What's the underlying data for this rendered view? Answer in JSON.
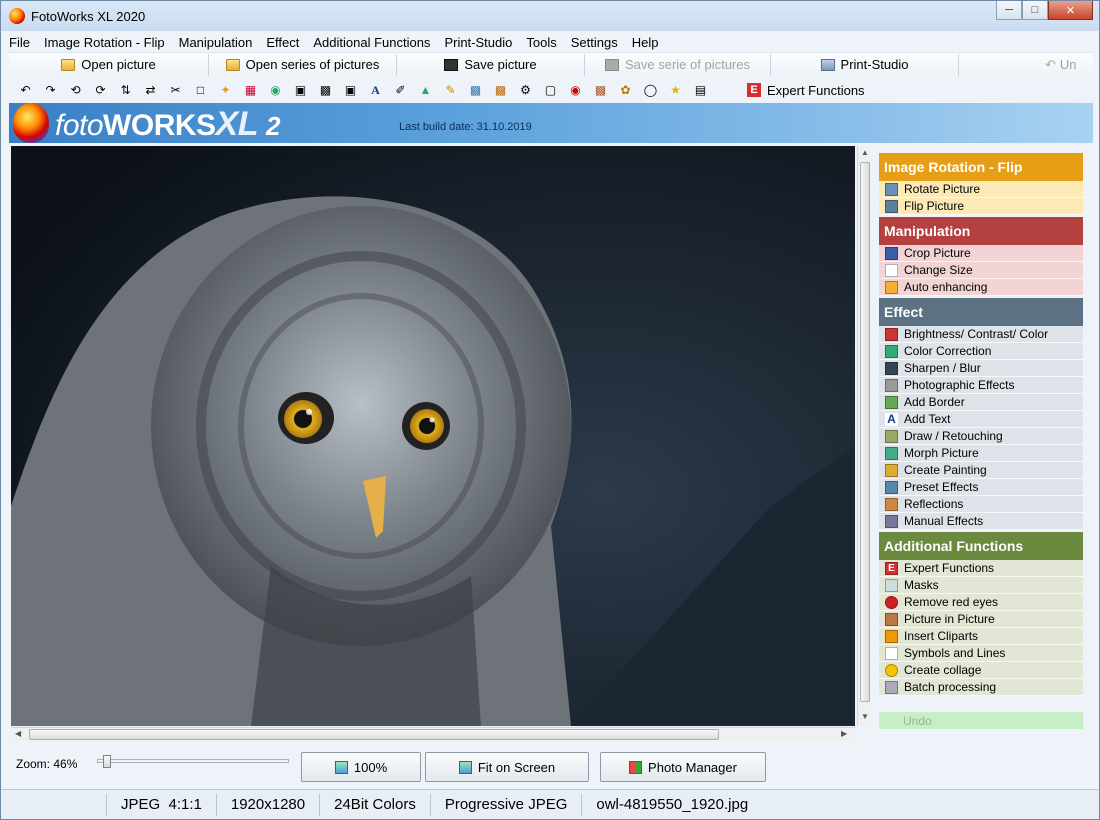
{
  "window": {
    "title": "FotoWorks XL 2020"
  },
  "menu": [
    "File",
    "Image Rotation - Flip",
    "Manipulation",
    "Effect",
    "Additional Functions",
    "Print-Studio",
    "Tools",
    "Settings",
    "Help"
  ],
  "toolbar": {
    "open_picture": "Open picture",
    "open_series": "Open series of pictures",
    "save_picture": "Save picture",
    "save_serie": "Save serie of pictures",
    "print_studio": "Print-Studio",
    "undo_partial": "Un",
    "expert_functions": "Expert Functions"
  },
  "banner": {
    "logo_foto": "foto",
    "logo_works": "WORKS",
    "logo_xl": "XL",
    "logo_version": "2",
    "build_date": "Last build date: 31.10.2019"
  },
  "sidebar": {
    "sections": [
      {
        "title": "Image Rotation - Flip",
        "items": [
          "Rotate Picture",
          "Flip Picture"
        ]
      },
      {
        "title": "Manipulation",
        "items": [
          "Crop Picture",
          "Change Size",
          "Auto enhancing"
        ]
      },
      {
        "title": "Effect",
        "items": [
          "Brightness/ Contrast/ Color",
          "Color Correction",
          "Sharpen / Blur",
          "Photographic Effects",
          "Add Border",
          "Add Text",
          "Draw / Retouching",
          "Morph Picture",
          "Create Painting",
          "Preset Effects",
          "Reflections",
          "Manual Effects"
        ]
      },
      {
        "title": "Additional Functions",
        "items": [
          "Expert Functions",
          "Masks",
          "Remove red eyes",
          "Picture in Picture",
          "Insert Cliparts",
          "Symbols and Lines",
          "Create collage",
          "Batch processing"
        ]
      }
    ],
    "undo": "Undo"
  },
  "zoom": {
    "label": "Zoom: 46%",
    "level_percent": 46
  },
  "buttons": {
    "hundred": "100%",
    "fit": "Fit on Screen",
    "photo_manager": "Photo Manager"
  },
  "status": {
    "format": "JPEG  4:1:1",
    "size": "1920x1280",
    "colors": "24Bit Colors",
    "encoding": "Progressive JPEG",
    "file": "owl-4819550_1920.jpg"
  }
}
